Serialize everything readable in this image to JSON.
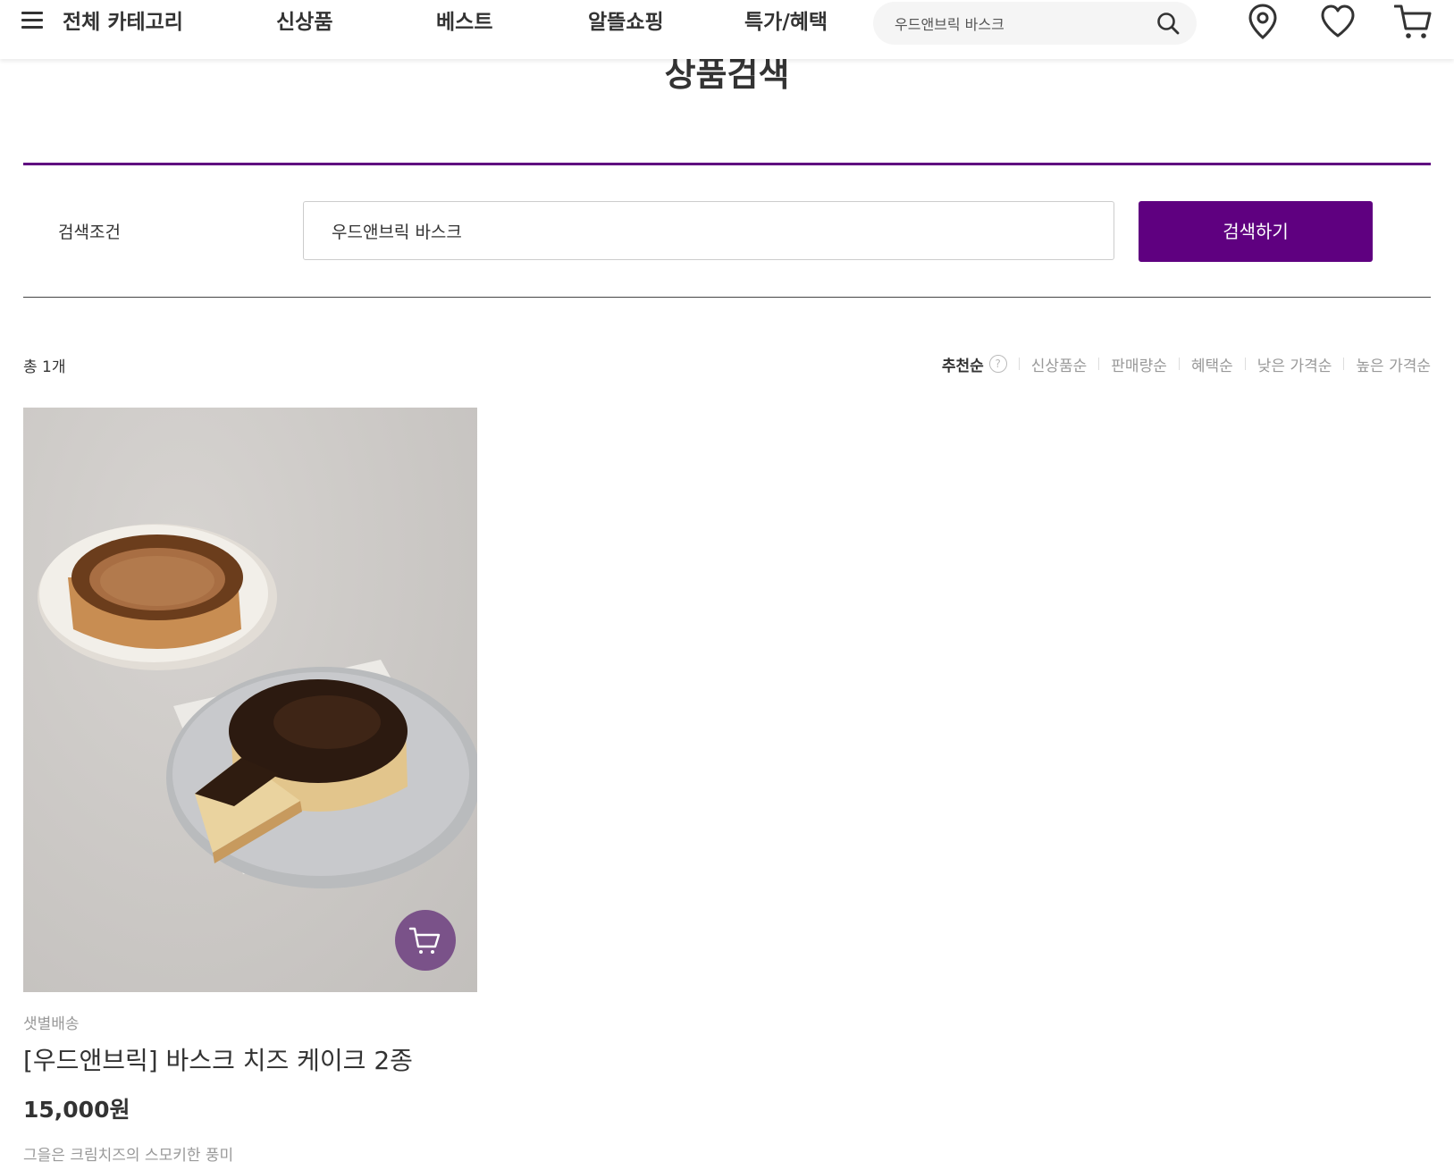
{
  "header": {
    "category_label": "전체 카테고리",
    "nav": [
      "신상품",
      "베스트",
      "알뜰쇼핑",
      "특가/혜택"
    ],
    "search_value": "우드앤브릭 바스크",
    "icons": [
      "menu-icon",
      "search-icon",
      "location-pin-icon",
      "heart-icon",
      "cart-icon"
    ],
    "accent_color": "#5f0080"
  },
  "page": {
    "title": "상품검색"
  },
  "search_condition": {
    "label": "검색조건",
    "value": "우드앤브릭 바스크",
    "button": "검색하기"
  },
  "results": {
    "total": "총 1개",
    "sort_options": [
      "추천순",
      "신상품순",
      "판매량순",
      "혜택순",
      "낮은 가격순",
      "높은 가격순"
    ],
    "active_sort": "추천순",
    "help_glyph": "?"
  },
  "products": [
    {
      "delivery": "샛별배송",
      "name": "[우드앤브릭] 바스크 치즈 케이크 2종",
      "price": "15,000원",
      "description": "그을은 크림치즈의 스모키한 풍미",
      "cart_button_color": "#7a5289"
    }
  ]
}
